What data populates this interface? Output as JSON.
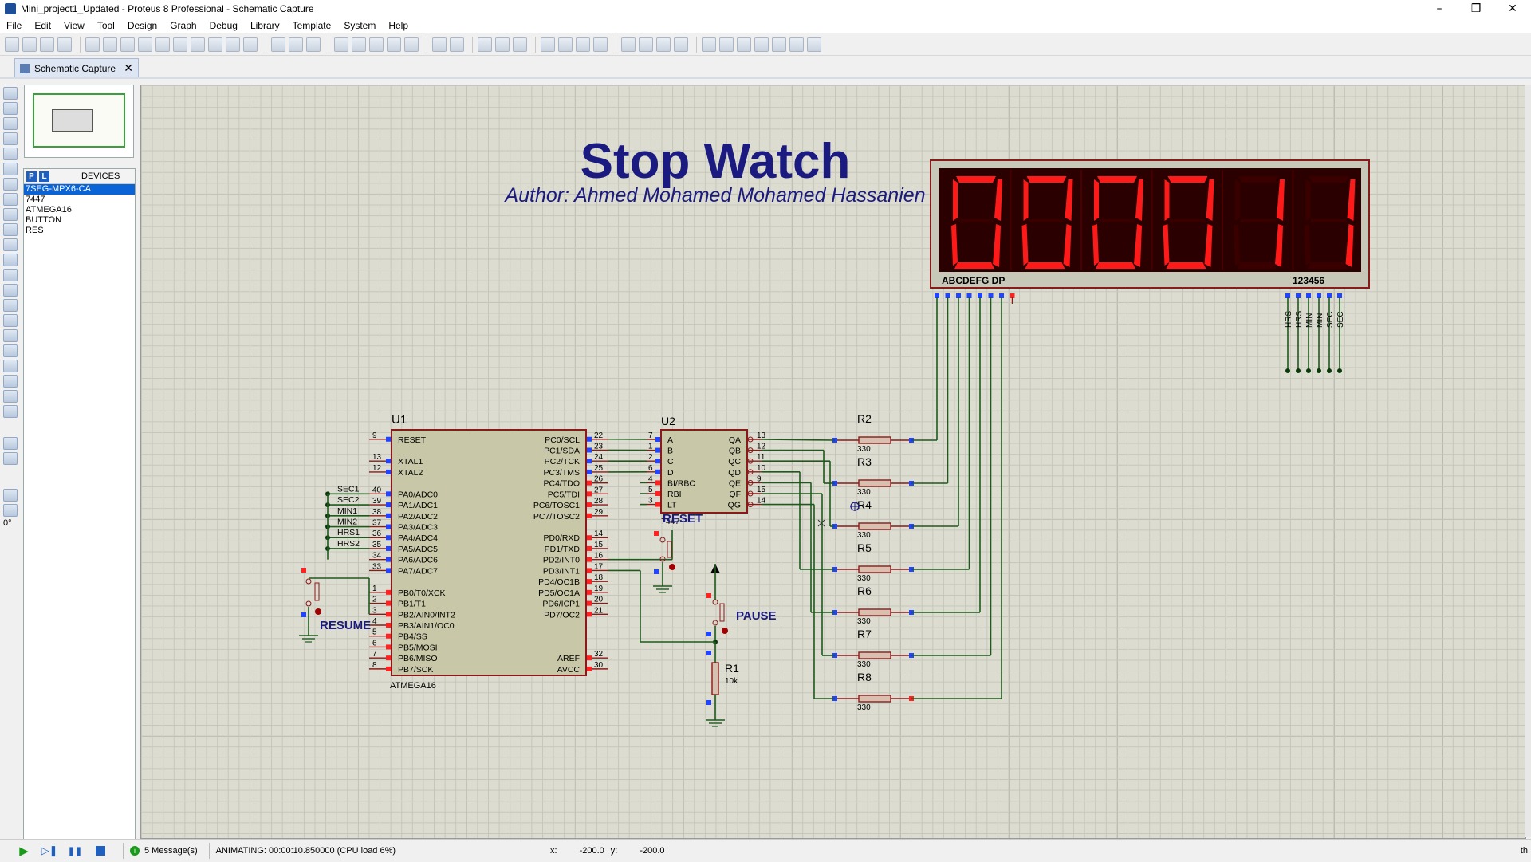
{
  "window": {
    "title": "Mini_project1_Updated - Proteus 8 Professional - Schematic Capture",
    "minimize": "–",
    "maximize": "❒",
    "close": "✕"
  },
  "menu": [
    "File",
    "Edit",
    "View",
    "Tool",
    "Design",
    "Graph",
    "Debug",
    "Library",
    "Template",
    "System",
    "Help"
  ],
  "tab": {
    "label": "Schematic Capture",
    "close": "✕"
  },
  "devices": {
    "p_label": "P",
    "l_label": "L",
    "title": "DEVICES",
    "items": [
      "7SEG-MPX6-CA",
      "7447",
      "ATMEGA16",
      "BUTTON",
      "RES"
    ],
    "selected": "7SEG-MPX6-CA"
  },
  "angle": "0°",
  "schematic": {
    "title": "Stop Watch",
    "author": "Author: Ahmed Mohamed Mohamed Hassanien",
    "display": {
      "digits": [
        "0",
        "0",
        "0",
        "0",
        "1",
        "1"
      ],
      "segment_pins_label": "ABCDEFG  DP",
      "digit_pins_label": "123456",
      "digit_net_labels": [
        "HRS",
        "HRS",
        "MIN",
        "MIN",
        "SEC",
        "SEC"
      ],
      "segment_color": "#ff1a1a",
      "body_color": "#2a0000"
    },
    "u1": {
      "ref": "U1",
      "part": "ATMEGA16",
      "left_pins": [
        {
          "num": "9",
          "name": "RESET"
        },
        {
          "num": "13",
          "name": "XTAL1"
        },
        {
          "num": "12",
          "name": "XTAL2"
        },
        {
          "num": "40",
          "name": "PA0/ADC0"
        },
        {
          "num": "39",
          "name": "PA1/ADC1"
        },
        {
          "num": "38",
          "name": "PA2/ADC2"
        },
        {
          "num": "37",
          "name": "PA3/ADC3"
        },
        {
          "num": "36",
          "name": "PA4/ADC4"
        },
        {
          "num": "35",
          "name": "PA5/ADC5"
        },
        {
          "num": "34",
          "name": "PA6/ADC6"
        },
        {
          "num": "33",
          "name": "PA7/ADC7"
        },
        {
          "num": "1",
          "name": "PB0/T0/XCK"
        },
        {
          "num": "2",
          "name": "PB1/T1"
        },
        {
          "num": "3",
          "name": "PB2/AIN0/INT2"
        },
        {
          "num": "4",
          "name": "PB3/AIN1/OC0"
        },
        {
          "num": "5",
          "name": "PB4/SS"
        },
        {
          "num": "6",
          "name": "PB5/MOSI"
        },
        {
          "num": "7",
          "name": "PB6/MISO"
        },
        {
          "num": "8",
          "name": "PB7/SCK"
        }
      ],
      "right_pins": [
        {
          "num": "22",
          "name": "PC0/SCL"
        },
        {
          "num": "23",
          "name": "PC1/SDA"
        },
        {
          "num": "24",
          "name": "PC2/TCK"
        },
        {
          "num": "25",
          "name": "PC3/TMS"
        },
        {
          "num": "26",
          "name": "PC4/TDO"
        },
        {
          "num": "27",
          "name": "PC5/TDI"
        },
        {
          "num": "28",
          "name": "PC6/TOSC1"
        },
        {
          "num": "29",
          "name": "PC7/TOSC2"
        },
        {
          "num": "14",
          "name": "PD0/RXD"
        },
        {
          "num": "15",
          "name": "PD1/TXD"
        },
        {
          "num": "16",
          "name": "PD2/INT0"
        },
        {
          "num": "17",
          "name": "PD3/INT1"
        },
        {
          "num": "18",
          "name": "PD4/OC1B"
        },
        {
          "num": "19",
          "name": "PD5/OC1A"
        },
        {
          "num": "20",
          "name": "PD6/ICP1"
        },
        {
          "num": "21",
          "name": "PD7/OC2"
        },
        {
          "num": "32",
          "name": "AREF"
        },
        {
          "num": "30",
          "name": "AVCC"
        }
      ],
      "net_labels": [
        "SEC1",
        "SEC2",
        "MIN1",
        "MIN2",
        "HRS1",
        "HRS2"
      ]
    },
    "u2": {
      "ref": "U2",
      "part": "7447",
      "left_pins": [
        {
          "num": "7",
          "name": "A"
        },
        {
          "num": "1",
          "name": "B"
        },
        {
          "num": "2",
          "name": "C"
        },
        {
          "num": "6",
          "name": "D"
        },
        {
          "num": "4",
          "name": "BI/RBO"
        },
        {
          "num": "5",
          "name": "RBI"
        },
        {
          "num": "3",
          "name": "LT"
        }
      ],
      "right_pins": [
        {
          "num": "13",
          "name": "QA"
        },
        {
          "num": "12",
          "name": "QB"
        },
        {
          "num": "11",
          "name": "QC"
        },
        {
          "num": "10",
          "name": "QD"
        },
        {
          "num": "9",
          "name": "QE"
        },
        {
          "num": "15",
          "name": "QF"
        },
        {
          "num": "14",
          "name": "QG"
        }
      ]
    },
    "resistors": [
      {
        "ref": "R2",
        "value": "330"
      },
      {
        "ref": "R3",
        "value": "330"
      },
      {
        "ref": "R4",
        "value": "330"
      },
      {
        "ref": "R5",
        "value": "330"
      },
      {
        "ref": "R6",
        "value": "330"
      },
      {
        "ref": "R7",
        "value": "330"
      },
      {
        "ref": "R8",
        "value": "330"
      }
    ],
    "r1": {
      "ref": "R1",
      "value": "10k"
    },
    "buttons": {
      "reset": "RESET",
      "pause": "PAUSE",
      "resume": "RESUME"
    }
  },
  "status": {
    "messages": "5 Message(s)",
    "animating": "ANIMATING: 00:00:10.850000 (CPU load 6%)",
    "x_label": "x:",
    "x_value": "-200.0",
    "y_label": "y:",
    "y_value": "-200.0",
    "tail": "th"
  },
  "colors": {
    "wire": "#1e5a1e",
    "chip_fill": "#c8c8a8",
    "chip_border": "#8a1a1a",
    "pin_blue": "#2244ff",
    "pin_red": "#ff2222",
    "text_blue": "#1a1a80"
  }
}
